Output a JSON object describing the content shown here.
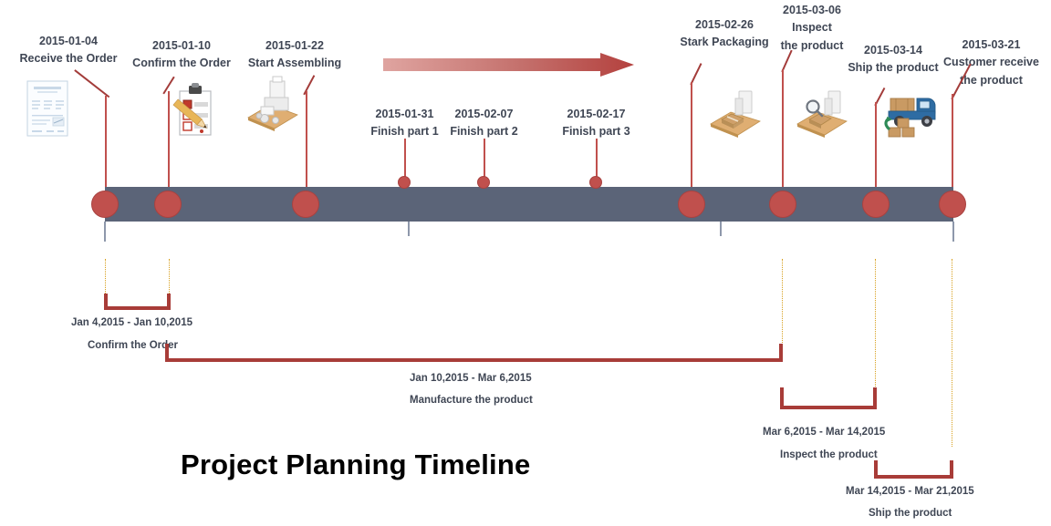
{
  "title": "Project Planning Timeline",
  "colors": {
    "bar": "#5b6478",
    "marker": "#c0504d",
    "bracket": "#a83c38",
    "guide_dotted": "#d8a01e",
    "text": "#3f4654",
    "title": "#000000",
    "arrow_light": "#dd9b97",
    "arrow_dark": "#b4413e"
  },
  "timeline": {
    "start_label": "2015-01-04",
    "end_label": "2015-03-21",
    "milestones": [
      {
        "date": "2015-01-04",
        "name": "Receive the Order",
        "icon": "invoice-document-icon",
        "marker": "large",
        "position": "above"
      },
      {
        "date": "2015-01-10",
        "name": "Confirm the Order",
        "icon": "checklist-pencil-icon",
        "marker": "large",
        "position": "above"
      },
      {
        "date": "2015-01-22",
        "name": "Start Assembling",
        "icon": "assembly-machine-icon",
        "marker": "large",
        "position": "above"
      },
      {
        "date": "2015-01-31",
        "name": "Finish part 1",
        "icon": "none",
        "marker": "small",
        "position": "above"
      },
      {
        "date": "2015-02-07",
        "name": "Finish part 2",
        "icon": "none",
        "marker": "small",
        "position": "above"
      },
      {
        "date": "2015-02-17",
        "name": "Finish part 3",
        "icon": "none",
        "marker": "small",
        "position": "above"
      },
      {
        "date": "2015-02-26",
        "name": "Stark Packaging",
        "icon": "packaging-box-icon",
        "marker": "large",
        "position": "above"
      },
      {
        "date": "2015-03-06",
        "name": "Inspect the product",
        "icon": "inspect-magnifier-icon",
        "marker": "large",
        "position": "above"
      },
      {
        "date": "2015-03-14",
        "name": "Ship the product",
        "icon": "delivery-truck-icon",
        "marker": "large",
        "position": "above"
      },
      {
        "date": "2015-03-21",
        "name": "Customer receive the product",
        "icon": "none",
        "marker": "large",
        "position": "above"
      }
    ]
  },
  "milestone_labels": {
    "m0_date": "2015-01-04",
    "m0_name": "Receive the Order",
    "m1_date": "2015-01-10",
    "m1_name": "Confirm the Order",
    "m2_date": "2015-01-22",
    "m2_name": "Start Assembling",
    "m3_date": "2015-01-31",
    "m3_name": "Finish part 1",
    "m4_date": "2015-02-07",
    "m4_name": "Finish part 2",
    "m5_date": "2015-02-17",
    "m5_name": "Finish part 3",
    "m6_date": "2015-02-26",
    "m6_name": "Stark Packaging",
    "m7_date": "2015-03-06",
    "m7_name_l1": "Inspect",
    "m7_name_l2": "the product",
    "m8_date": "2015-03-14",
    "m8_name": "Ship the product",
    "m9_date": "2015-03-21",
    "m9_name_l1": "Customer receive",
    "m9_name_l2": "the product"
  },
  "phases": [
    {
      "range": "Jan 4,2015 - Jan 10,2015",
      "name": "Confirm the Order"
    },
    {
      "range": "Jan 10,2015 - Mar 6,2015",
      "name": "Manufacture the product"
    },
    {
      "range": "Mar 6,2015 - Mar 14,2015",
      "name": "Inspect the product"
    },
    {
      "range": "Mar 14,2015 - Mar 21,2015",
      "name": "Ship the product"
    }
  ],
  "phase_labels": {
    "p0_range": "Jan 4,2015 - Jan 10,2015",
    "p0_name": "Confirm the Order",
    "p1_range": "Jan 10,2015 - Mar 6,2015",
    "p1_name": "Manufacture the product",
    "p2_range": "Mar 6,2015 - Mar 14,2015",
    "p2_name": "Inspect the product",
    "p3_range": "Mar 14,2015 - Mar 21,2015",
    "p3_name": "Ship the product"
  },
  "arrow": {
    "direction": "right",
    "meaning": "assembly-progress-arrow"
  }
}
